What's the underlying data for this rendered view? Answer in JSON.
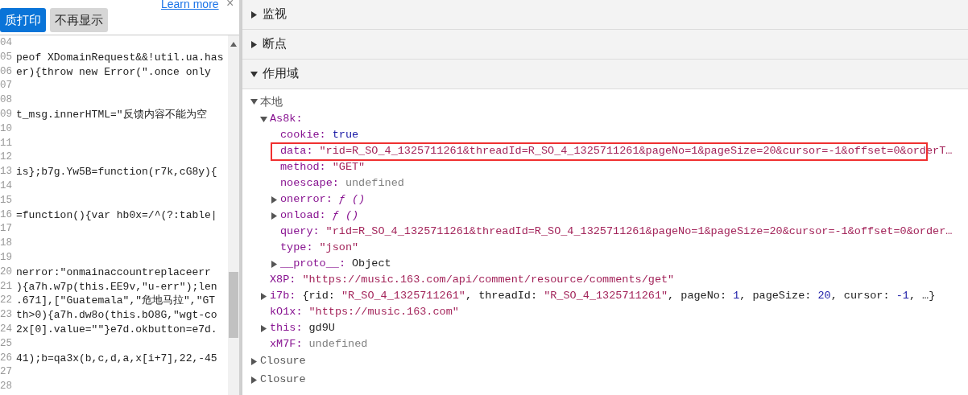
{
  "notice_bar": {
    "link": "Learn more",
    "close": "×",
    "buttons": [
      {
        "label": "质打印",
        "kind": "primary"
      },
      {
        "label": "不再显示",
        "kind": "secondary"
      }
    ]
  },
  "code_editor": {
    "lines": [
      {
        "number": "04"
      },
      {
        "number": "05",
        "code": "peof XDomainRequest&&!util.ua.has"
      },
      {
        "number": "06",
        "code": "er){throw new Error(\".once only"
      },
      {
        "number": "07"
      },
      {
        "number": "08"
      },
      {
        "number": "09",
        "code": "t_msg.innerHTML=\"反馈内容不能为空"
      },
      {
        "number": "10"
      },
      {
        "number": "11"
      },
      {
        "number": "12"
      },
      {
        "number": "13",
        "code": "is};b7g.Yw5B=function(r7k,cG8y){"
      },
      {
        "number": "14"
      },
      {
        "number": "15"
      },
      {
        "number": "16",
        "code": "=function(){var hb0x=/^(?:table|"
      },
      {
        "number": "17"
      },
      {
        "number": "18"
      },
      {
        "number": "19"
      },
      {
        "number": "20",
        "code": "nerror:\"onmainaccountreplaceerr"
      },
      {
        "number": "21",
        "code": "){a7h.w7p(this.EE9v,\"u-err\");len"
      },
      {
        "number": "22",
        "code": ".671],[\"Guatemala\",\"危地马拉\",\"GT"
      },
      {
        "number": "23",
        "code": "th>0){a7h.dw8o(this.bO8G,\"wgt-co"
      },
      {
        "number": "24",
        "code": "2x[0].value=\"\"}e7d.okbutton=e7d."
      },
      {
        "number": "25"
      },
      {
        "number": "26",
        "code": "41);b=qa3x(b,c,d,a,x[i+7],22,-45"
      },
      {
        "number": "27"
      },
      {
        "number": "28"
      }
    ]
  },
  "sections": [
    {
      "title": "监视",
      "expanded": false
    },
    {
      "title": "断点",
      "expanded": false
    },
    {
      "title": "作用域",
      "expanded": true
    }
  ],
  "scope_tree": [
    {
      "kind": "scope",
      "label": "本地",
      "expanded": true,
      "children": [
        {
          "kind": "object",
          "key": "As8k:",
          "expanded": true,
          "children": [
            {
              "kind": "boolean",
              "key": "cookie:",
              "value": "true"
            },
            {
              "kind": "string",
              "key": "data:",
              "value": "\"rid=R_SO_4_1325711261&threadId=R_SO_4_1325711261&pageNo=1&pageSize=20&cursor=-1&offset=0&orderT…",
              "highlighted": true
            },
            {
              "kind": "string",
              "key": "method:",
              "value": "\"GET\""
            },
            {
              "kind": "undefined",
              "key": "noescape:",
              "value": "undefined"
            },
            {
              "kind": "function",
              "key": "onerror:",
              "value": "ƒ ()",
              "expanded": false
            },
            {
              "kind": "function",
              "key": "onload:",
              "value": "ƒ ()",
              "expanded": false
            },
            {
              "kind": "string",
              "key": "query:",
              "value": "\"rid=R_SO_4_1325711261&threadId=R_SO_4_1325711261&pageNo=1&pageSize=20&cursor=-1&offset=0&order…"
            },
            {
              "kind": "string",
              "key": "type:",
              "value": "\"json\""
            },
            {
              "kind": "plain",
              "key": "__proto__:",
              "value": "Object",
              "expanded": false
            }
          ]
        },
        {
          "kind": "string",
          "key": "X8P:",
          "value": "\"https://music.163.com/api/comment/resource/comments/get\""
        },
        {
          "kind": "preview",
          "key": "i7b:",
          "expanded": false,
          "parts": [
            {
              "kind": "plain",
              "text": "{rid: "
            },
            {
              "kind": "string",
              "text": "\"R_SO_4_1325711261\""
            },
            {
              "kind": "plain",
              "text": ", threadId: "
            },
            {
              "kind": "string",
              "text": "\"R_SO_4_1325711261\""
            },
            {
              "kind": "plain",
              "text": ", pageNo: "
            },
            {
              "kind": "number",
              "text": "1"
            },
            {
              "kind": "plain",
              "text": ", pageSize: "
            },
            {
              "kind": "number",
              "text": "20"
            },
            {
              "kind": "plain",
              "text": ", cursor: "
            },
            {
              "kind": "number",
              "text": "-1"
            },
            {
              "kind": "plain",
              "text": ", …}"
            }
          ]
        },
        {
          "kind": "string",
          "key": "kO1x:",
          "value": "\"https://music.163.com\""
        },
        {
          "kind": "plain",
          "key": "this:",
          "value": "gd9U",
          "expanded": false
        },
        {
          "kind": "undefined",
          "key": "xM7F:",
          "value": "undefined"
        }
      ]
    },
    {
      "kind": "scope",
      "label": "Closure",
      "expanded": false
    },
    {
      "kind": "scope",
      "label": "Closure",
      "expanded": false
    }
  ]
}
